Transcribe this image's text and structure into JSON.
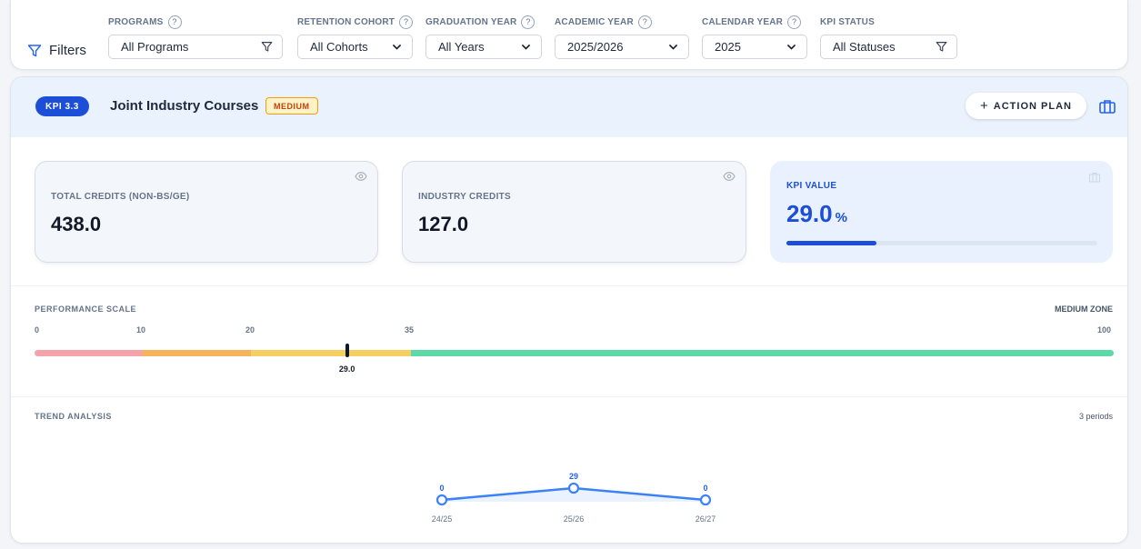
{
  "filters": {
    "label": "Filters",
    "groups": [
      {
        "label": "Programs",
        "value": "All Programs",
        "icon": "funnel-icon",
        "help": "?"
      },
      {
        "label": "Retention Cohort",
        "value": "All Cohorts",
        "icon": "chevron-down-icon",
        "help": "?"
      },
      {
        "label": "Graduation Year",
        "value": "All Years",
        "icon": "chevron-down-icon",
        "help": "?"
      },
      {
        "label": "Academic Year",
        "value": "2025/2026",
        "icon": "chevron-down-icon",
        "help": "?"
      },
      {
        "label": "Calendar Year",
        "value": "2025",
        "icon": "chevron-down-icon",
        "help": "?"
      },
      {
        "label": "KPI Status",
        "value": "All Statuses",
        "icon": "funnel-icon",
        "help": ""
      }
    ]
  },
  "kpi": {
    "badge": "KPI 3.3",
    "title": "Joint Industry Courses",
    "level": "MEDIUM",
    "action_label": "ACTION PLAN",
    "action_plus": "+"
  },
  "metrics": {
    "total": {
      "label": "TOTAL CREDITS (NON-BS/GE)",
      "value": "438.0"
    },
    "industry": {
      "label": "INDUSTRY CREDITS",
      "value": "127.0"
    },
    "kpi_value": {
      "label": "KPI VALUE",
      "value": "29.0",
      "unit": "%",
      "fraction": 0.29
    }
  },
  "scale": {
    "title": "PERFORMANCE SCALE",
    "zone": "MEDIUM ZONE",
    "ticks": [
      "0",
      "10",
      "20",
      "35",
      "100"
    ],
    "marker_value": 29.0,
    "marker_label": "29.0",
    "segments": [
      {
        "from": 0,
        "to": 10,
        "color": "#f4a3ab"
      },
      {
        "from": 10,
        "to": 20,
        "color": "#f6b35c"
      },
      {
        "from": 20,
        "to": 35,
        "color": "#f4d062"
      },
      {
        "from": 35,
        "to": 100,
        "color": "#5dd9a8"
      }
    ]
  },
  "trend": {
    "title": "TREND ANALYSIS",
    "periods_label": "3 periods",
    "points": [
      {
        "period": "24/25",
        "value": 0,
        "label": "0"
      },
      {
        "period": "25/26",
        "value": 29,
        "label": "29"
      },
      {
        "period": "26/27",
        "value": 0,
        "label": "0"
      }
    ],
    "color": "#3b82f6"
  },
  "colors": {
    "accent": "#1d4ed8",
    "medium_badge_bg": "#fef3c7",
    "medium_badge_text": "#c2410c"
  }
}
